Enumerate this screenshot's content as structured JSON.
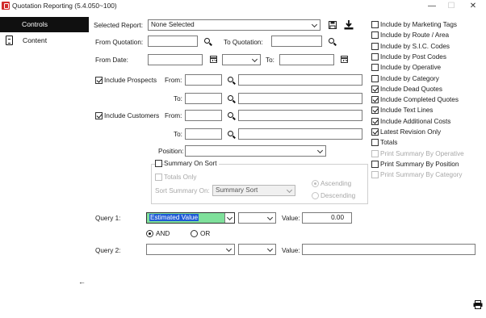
{
  "window": {
    "title": "Quotation Reporting (5.4.050~100)",
    "minimize_glyph": "—",
    "maximize_glyph": "☐",
    "close_glyph": "✕"
  },
  "sidebar": {
    "items": [
      {
        "label": "Controls",
        "active": true
      },
      {
        "label": "Content",
        "active": false,
        "icon": "document-icon"
      }
    ]
  },
  "report": {
    "selected_report_label": "Selected Report:",
    "selected_report_value": "None Selected"
  },
  "quotation": {
    "from_label": "From Quotation:",
    "from_value": "",
    "to_label": "To Quotation:",
    "to_value": ""
  },
  "date": {
    "from_label": "From Date:",
    "from_value": "",
    "range_value": "",
    "to_label": "To:",
    "to_value": ""
  },
  "prospects": {
    "checkbox_label": "Include Prospects",
    "checked": true,
    "from_label": "From:",
    "from_code": "",
    "from_name": "",
    "to_label": "To:",
    "to_code": "",
    "to_name": ""
  },
  "customers": {
    "checkbox_label": "Include Customers",
    "checked": true,
    "from_label": "From:",
    "from_code": "",
    "from_name": "",
    "to_label": "To:",
    "to_code": "",
    "to_name": ""
  },
  "position": {
    "label": "Position:",
    "value": ""
  },
  "summary": {
    "summary_on_sort_label": "Summary On Sort",
    "summary_on_sort_checked": false,
    "totals_only_label": "Totals Only",
    "sort_summary_on_label": "Sort Summary On:",
    "sort_summary_value": "Summary Sort",
    "ascending_label": "Ascending",
    "descending_label": "Descending"
  },
  "query1": {
    "label": "Query 1:",
    "field_value": "Estimated Value",
    "operator_value": "",
    "value_label": "Value:",
    "value": "0.00"
  },
  "logic": {
    "and_label": "AND",
    "or_label": "OR",
    "selected": "AND"
  },
  "query2": {
    "label": "Query 2:",
    "field_value": "",
    "operator_value": "",
    "value_label": "Value:",
    "value": ""
  },
  "options": [
    {
      "label": "Include by Marketing Tags",
      "checked": false,
      "enabled": true
    },
    {
      "label": "Include by Route / Area",
      "checked": false,
      "enabled": true
    },
    {
      "label": "Include by S.I.C. Codes",
      "checked": false,
      "enabled": true
    },
    {
      "label": "Include by Post Codes",
      "checked": false,
      "enabled": true
    },
    {
      "label": "Include by Operative",
      "checked": false,
      "enabled": true
    },
    {
      "label": "Include by Category",
      "checked": false,
      "enabled": true
    },
    {
      "label": "Include Dead Quotes",
      "checked": true,
      "enabled": true
    },
    {
      "label": "Include Completed Quotes",
      "checked": true,
      "enabled": true
    },
    {
      "label": "Include Text Lines",
      "checked": true,
      "enabled": true
    },
    {
      "label": "Include Additional Costs",
      "checked": true,
      "enabled": true
    },
    {
      "label": "Latest Revision Only",
      "checked": true,
      "enabled": true
    },
    {
      "label": "Totals",
      "checked": false,
      "enabled": true
    },
    {
      "label": "Print Summary By Operative",
      "checked": false,
      "enabled": false
    },
    {
      "label": "Print Summary By Position",
      "checked": false,
      "enabled": true
    },
    {
      "label": "Print Summary By Category",
      "checked": false,
      "enabled": false
    }
  ],
  "icons": {
    "save": "save-icon",
    "download": "download-icon",
    "back": "back-arrow-icon",
    "print": "printer-icon",
    "back_glyph": "←"
  },
  "colors": {
    "sidebar_active_bg": "#101010",
    "selection_blue": "#1e5bd6",
    "selection_green": "#7fe09b",
    "app_icon_red": "#d22b2b"
  }
}
